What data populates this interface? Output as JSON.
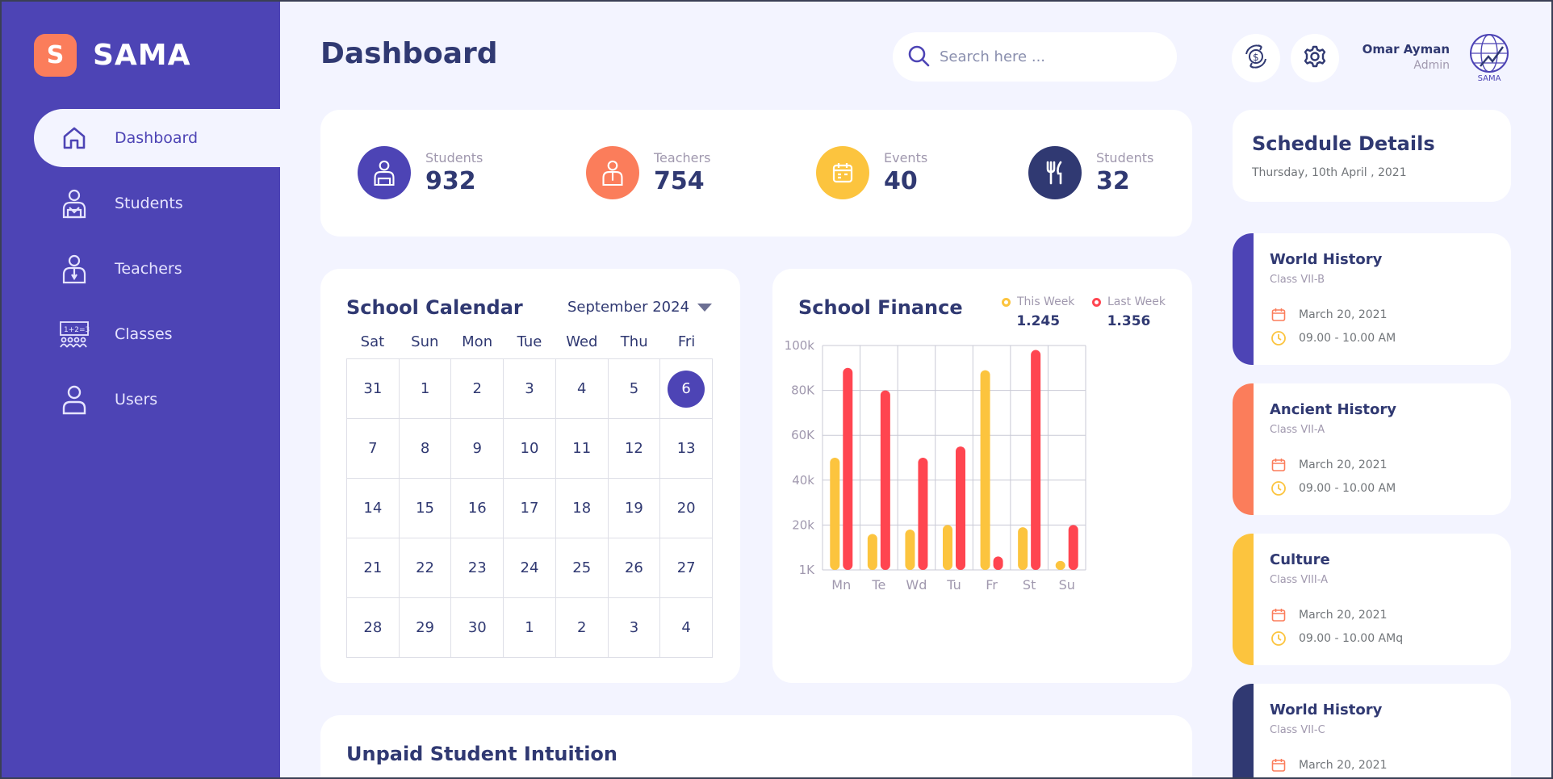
{
  "brand": {
    "logo_letter": "S",
    "name": "SAMA"
  },
  "nav": [
    {
      "label": "Dashboard",
      "icon": "home-icon",
      "active": true
    },
    {
      "label": "Students",
      "icon": "student-icon"
    },
    {
      "label": "Teachers",
      "icon": "teacher-icon"
    },
    {
      "label": "Classes",
      "icon": "classroom-icon"
    },
    {
      "label": "Users",
      "icon": "user-icon"
    }
  ],
  "header": {
    "title": "Dashboard",
    "search_placeholder": "Search here ...",
    "user_name": "Omar Ayman",
    "user_role": "Admin",
    "avatar_text": "SAMA"
  },
  "stats": [
    {
      "label": "Students",
      "value": "932",
      "color": "#4D44B5",
      "icon": "student-icon"
    },
    {
      "label": "Teachers",
      "value": "754",
      "color": "#FB7D5B",
      "icon": "teacher-icon"
    },
    {
      "label": "Events",
      "value": "40",
      "color": "#FCC43E",
      "icon": "calendar-icon"
    },
    {
      "label": "Students",
      "value": "32",
      "color": "#303972",
      "icon": "fork-knife-icon"
    }
  ],
  "calendar": {
    "title": "School Calendar",
    "month": "September 2024",
    "weekdays": [
      "Sat",
      "Sun",
      "Mon",
      "Tue",
      "Wed",
      "Thu",
      "Fri"
    ],
    "days": [
      "31",
      "1",
      "2",
      "3",
      "4",
      "5",
      "6",
      "7",
      "8",
      "9",
      "10",
      "11",
      "12",
      "13",
      "14",
      "15",
      "16",
      "17",
      "18",
      "19",
      "20",
      "21",
      "22",
      "23",
      "24",
      "25",
      "26",
      "27",
      "28",
      "29",
      "30",
      "1",
      "2",
      "3",
      "4"
    ],
    "selected_index": 6
  },
  "finance": {
    "title": "School Finance",
    "legend": [
      {
        "label": "This Week",
        "value": "1.245",
        "color": "#FCC43E"
      },
      {
        "label": "Last Week",
        "value": "1.356",
        "color": "#FF4550"
      }
    ]
  },
  "chart_data": {
    "type": "bar",
    "categories": [
      "Mn",
      "Te",
      "Wd",
      "Tu",
      "Fr",
      "St",
      "Su"
    ],
    "y_ticks": [
      "100k",
      "80K",
      "60K",
      "40k",
      "20k",
      "1K"
    ],
    "ylim": [
      0,
      100000
    ],
    "series": [
      {
        "name": "This Week",
        "color": "#FCC43E",
        "values": [
          50000,
          16000,
          18000,
          20000,
          89000,
          19000,
          4000
        ]
      },
      {
        "name": "Last Week",
        "color": "#FF4550",
        "values": [
          90000,
          80000,
          50000,
          55000,
          6000,
          98000,
          20000
        ]
      }
    ]
  },
  "unpaid": {
    "title": "Unpaid Student Intuition"
  },
  "schedule": {
    "title": "Schedule Details",
    "date": "Thursday, 10th April , 2021",
    "items": [
      {
        "title": "World History",
        "class": "Class VII-B",
        "date": "March 20, 2021",
        "time": "09.00 - 10.00 AM",
        "color": "#4D44B5"
      },
      {
        "title": "Ancient History",
        "class": "Class VII-A",
        "date": "March 20, 2021",
        "time": "09.00 - 10.00 AM",
        "color": "#FB7D5B"
      },
      {
        "title": "Culture",
        "class": "Class VIII-A",
        "date": "March 20, 2021",
        "time": "09.00 - 10.00 AMq",
        "color": "#FCC43E"
      },
      {
        "title": "World History",
        "class": "Class VII-C",
        "date": "March 20, 2021",
        "time": "",
        "color": "#303972"
      }
    ]
  }
}
